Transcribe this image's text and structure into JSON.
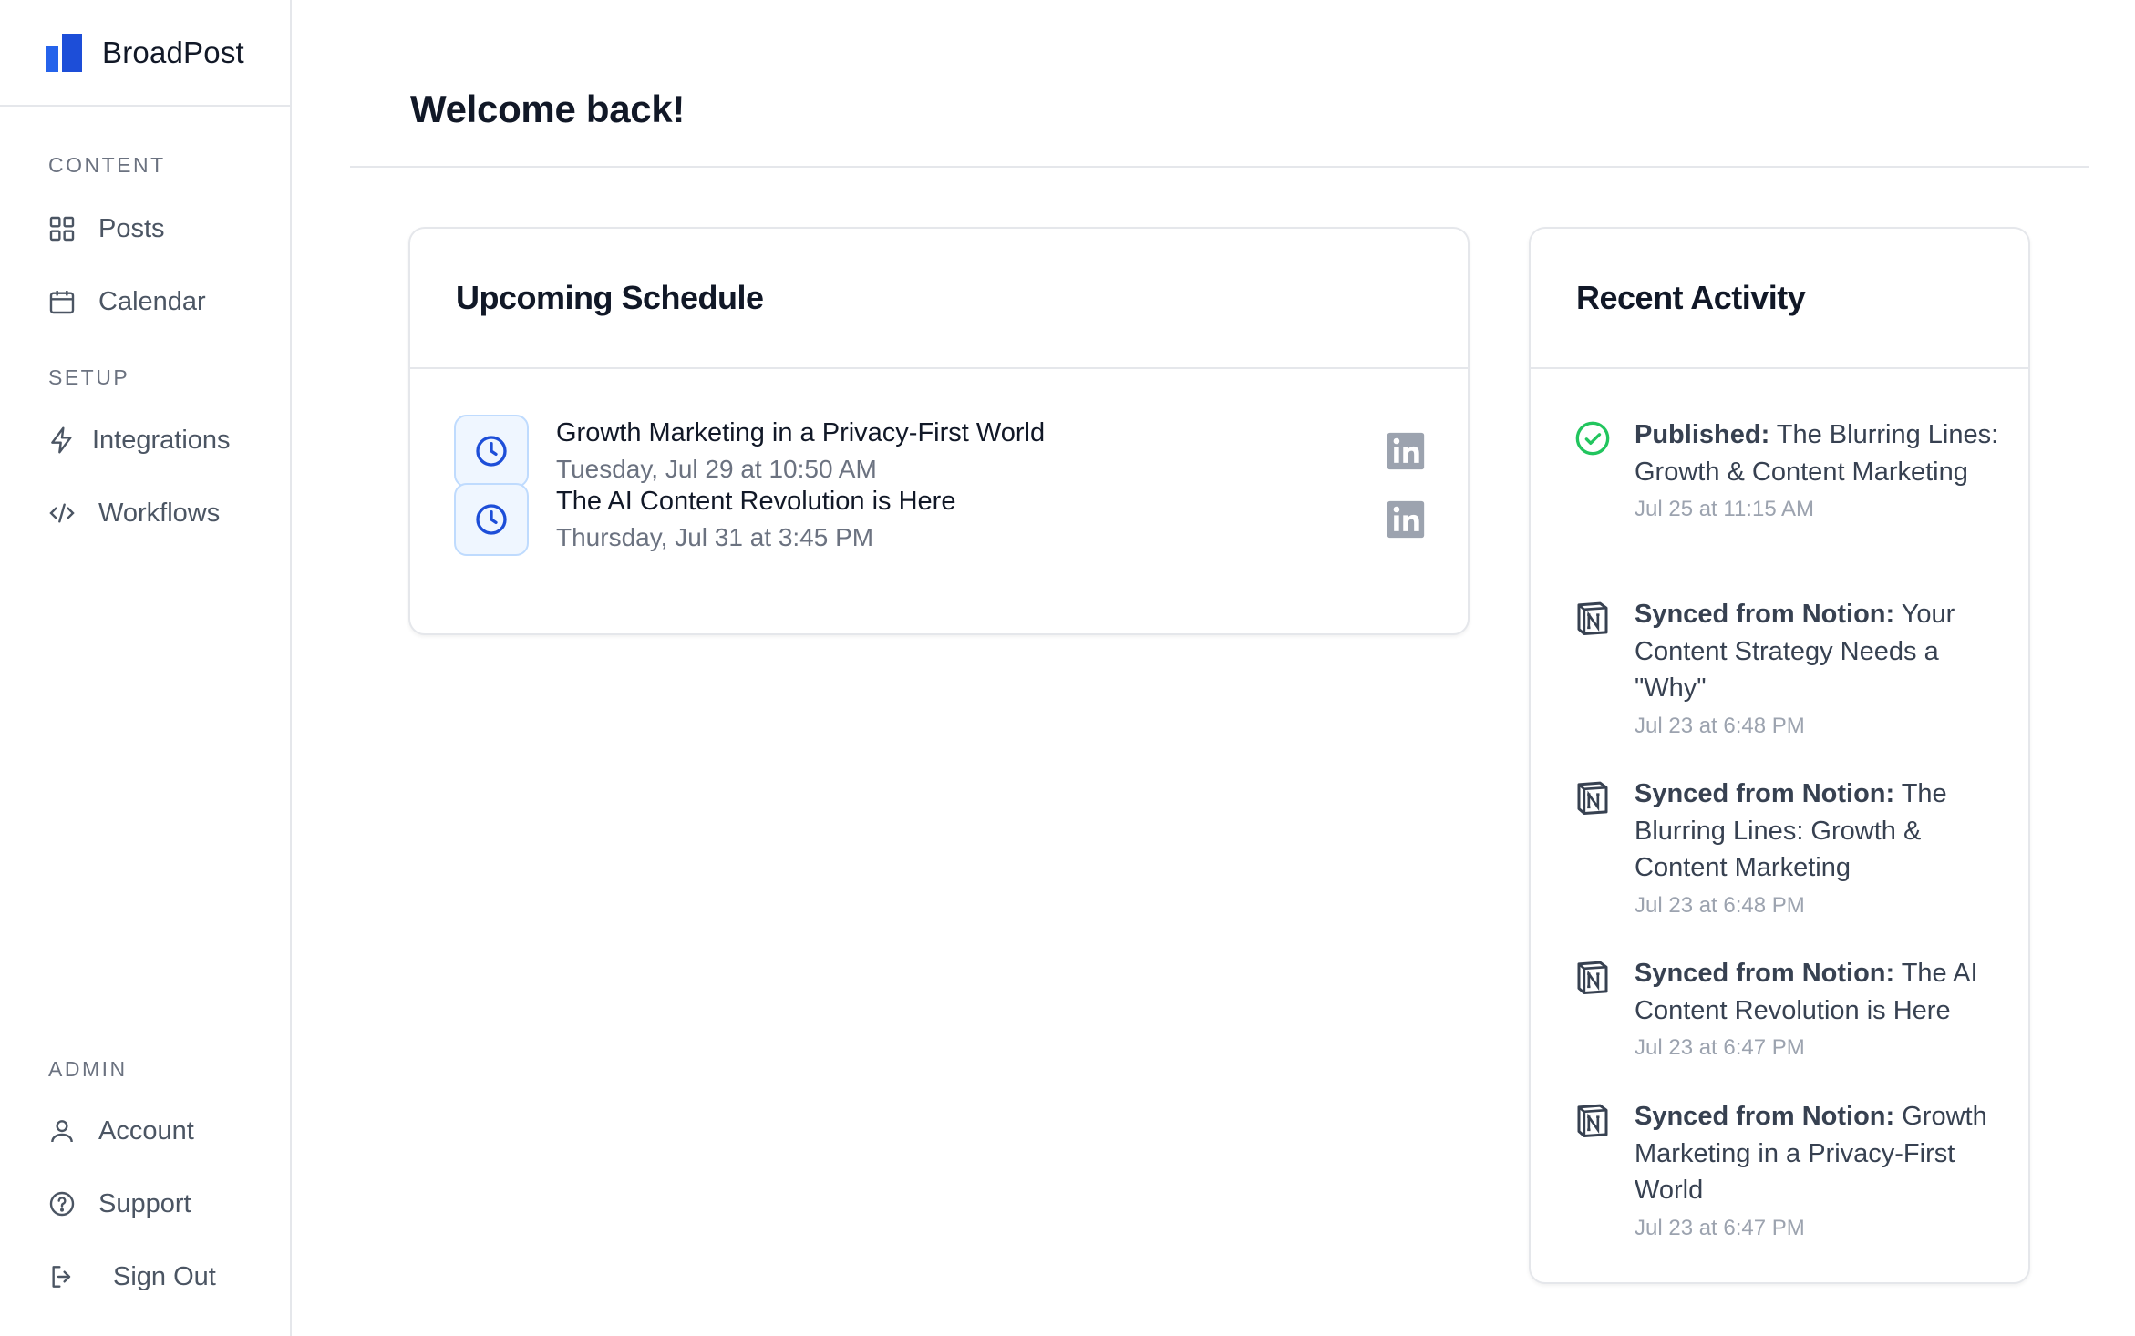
{
  "app": {
    "name": "BroadPost"
  },
  "sidebar": {
    "sections": {
      "content": "CONTENT",
      "setup": "SETUP",
      "admin": "ADMIN"
    },
    "items": {
      "posts": "Posts",
      "calendar": "Calendar",
      "integrations": "Integrations",
      "workflows": "Workflows",
      "account": "Account",
      "support": "Support",
      "signout": "Sign Out"
    }
  },
  "main": {
    "title": "Welcome back!"
  },
  "schedule": {
    "title": "Upcoming Schedule",
    "items": [
      {
        "title": "Growth Marketing in a Privacy-First World",
        "time": "Tuesday, Jul 29 at 10:50 AM",
        "platform_icon": "linkedin-icon"
      },
      {
        "title": "The AI Content Revolution is Here",
        "time": "Thursday, Jul 31 at 3:45 PM",
        "platform_icon": "linkedin-icon"
      }
    ]
  },
  "activity": {
    "title": "Recent Activity",
    "items": [
      {
        "icon": "check-circle-icon",
        "label": "Published:",
        "text": " The Blurring Lines: Growth & Content Marketing",
        "time": "Jul 25 at 11:15 AM"
      },
      {
        "icon": "notion-icon",
        "label": "Synced from Notion:",
        "text": " Your Content Strategy Needs a \"Why\"",
        "time": "Jul 23 at 6:48 PM"
      },
      {
        "icon": "notion-icon",
        "label": "Synced from Notion:",
        "text": " The Blurring Lines: Growth & Content Marketing",
        "time": "Jul 23 at 6:48 PM"
      },
      {
        "icon": "notion-icon",
        "label": "Synced from Notion:",
        "text": " The AI Content Revolution is Here",
        "time": "Jul 23 at 6:47 PM"
      },
      {
        "icon": "notion-icon",
        "label": "Synced from Notion:",
        "text": " Growth Marketing in a Privacy-First World",
        "time": "Jul 23 at 6:47 PM"
      }
    ]
  },
  "colors": {
    "accent": "#2563eb",
    "success": "#22c55e",
    "border": "#e5e7eb",
    "muted": "#6b7280"
  }
}
